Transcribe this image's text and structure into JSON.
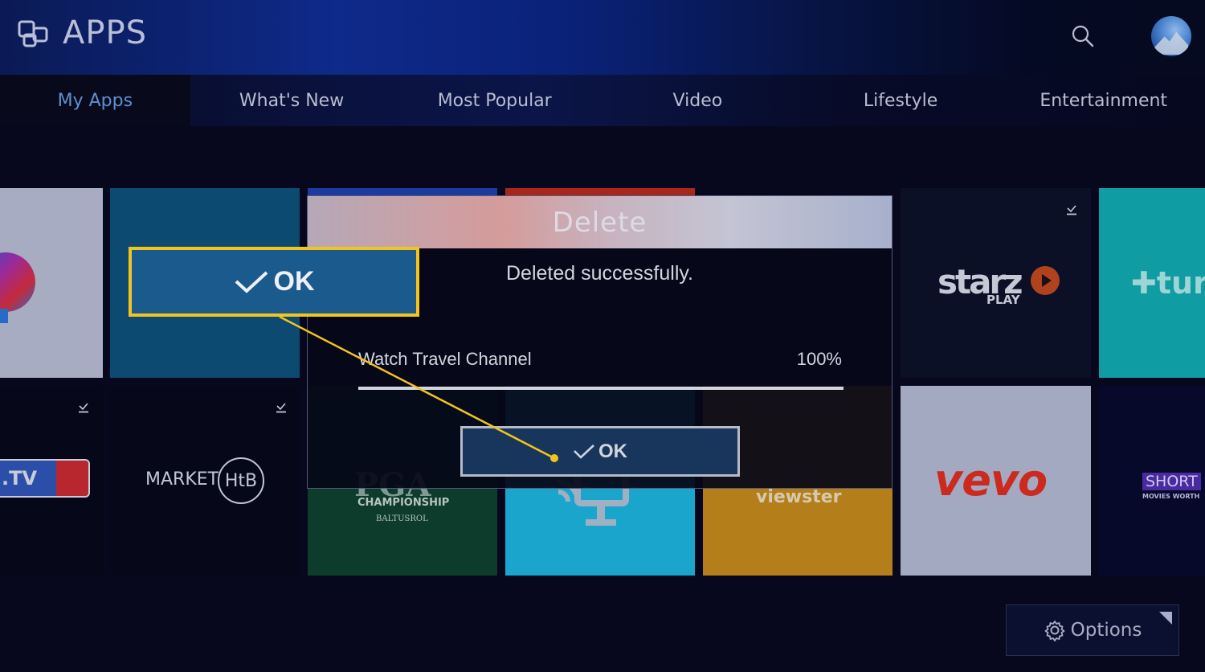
{
  "header": {
    "title": "APPS",
    "icons": {
      "apps": "apps-icon",
      "search": "search-icon",
      "avatar": "user-avatar"
    }
  },
  "tabs": [
    {
      "label": "My Apps",
      "active": true
    },
    {
      "label": "What's New",
      "active": false
    },
    {
      "label": "Most Popular",
      "active": false
    },
    {
      "label": "Video",
      "active": false
    },
    {
      "label": "Lifestyle",
      "active": false
    },
    {
      "label": "Entertainment",
      "active": false
    }
  ],
  "apps": {
    "row1": [
      {
        "name": "unknown-app-partial"
      },
      {
        "name": "selected-app"
      },
      {
        "name": "app-behind-dialog-blue"
      },
      {
        "name": "app-behind-dialog-red"
      },
      {
        "name": "Starz Play",
        "logo_text": "starz",
        "sub_text": "PLAY",
        "installed": true
      },
      {
        "name": "TuneIn",
        "logo_text": "tur"
      }
    ],
    "row2": [
      {
        "name": "MLB.TV",
        "logo_text": ".TV",
        "installed": true
      },
      {
        "name": "Market Hub",
        "logo_text": "MARKET",
        "badge_text": "HtB",
        "installed": true
      },
      {
        "name": "PGA Championship",
        "logo_text": "PGA",
        "sub_text": "CHAMPIONSHIP",
        "sub_text2": "BALTUSROL"
      },
      {
        "name": "Cast app"
      },
      {
        "name": "Viewster",
        "logo_text": "viewster"
      },
      {
        "name": "Vevo",
        "logo_text": "vevo"
      },
      {
        "name": "ShortsTV",
        "logo_text": "SHORT",
        "sub_text": "MOVIES WORTH"
      }
    ]
  },
  "dialog": {
    "title": "Delete",
    "message": "Deleted successfully.",
    "item_label": "Watch Travel Channel",
    "progress_text": "100%",
    "progress_fraction": 1.0,
    "ok_label": "OK"
  },
  "callout": {
    "label": "OK",
    "color": "#f4c41e"
  },
  "options": {
    "label": "Options"
  },
  "colors": {
    "accent_tab": "#5f8fcf",
    "highlight": "#f4c41e",
    "vevo_red": "#cc2a1e"
  }
}
